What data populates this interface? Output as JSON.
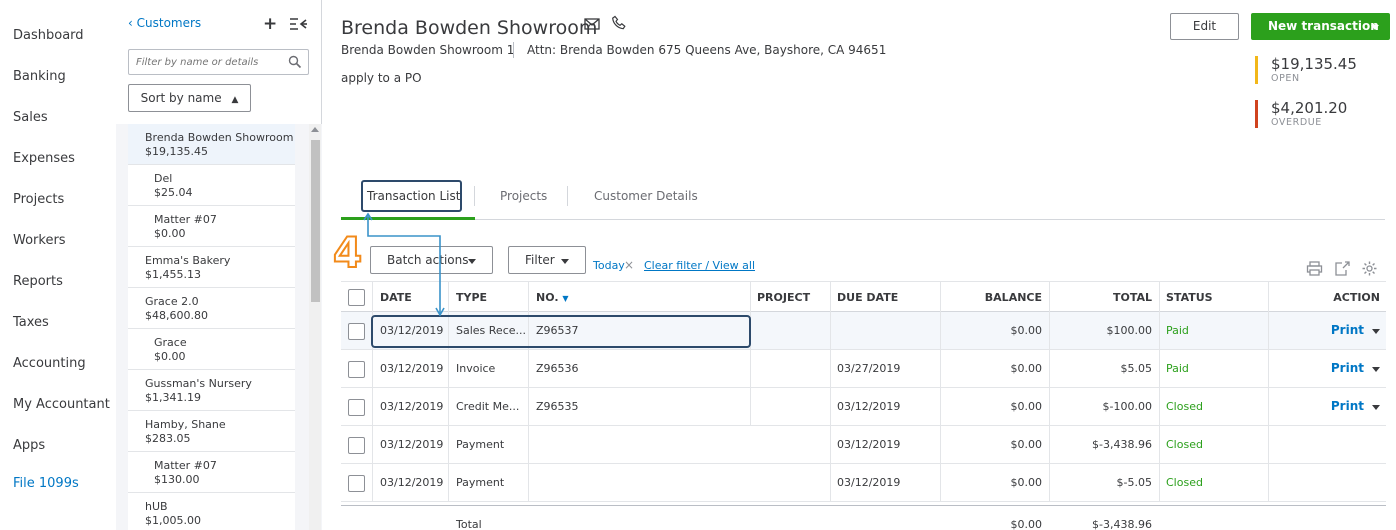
{
  "nav": {
    "items": [
      "Dashboard",
      "Banking",
      "Sales",
      "Expenses",
      "Projects",
      "Workers",
      "Reports",
      "Taxes",
      "Accounting",
      "My Accountant",
      "Apps",
      "File 1099s"
    ]
  },
  "custpanel": {
    "back_label": "Customers",
    "filter_placeholder": "Filter by name or details",
    "sort_label": "Sort by name",
    "customers": [
      {
        "name": "Brenda Bowden Showroom",
        "amount": "$19,135.45"
      },
      {
        "name": "Del",
        "amount": "$25.04"
      },
      {
        "name": "Matter #07",
        "amount": "$0.00"
      },
      {
        "name": "Emma's Bakery",
        "amount": "$1,455.13"
      },
      {
        "name": "Grace 2.0",
        "amount": "$48,600.80"
      },
      {
        "name": "Grace",
        "amount": "$0.00"
      },
      {
        "name": "Gussman's Nursery",
        "amount": "$1,341.19"
      },
      {
        "name": "Hamby, Shane",
        "amount": "$283.05"
      },
      {
        "name": "Matter #07",
        "amount": "$130.00"
      },
      {
        "name": "hUB",
        "amount": "$1,005.00"
      }
    ]
  },
  "header": {
    "title": "Brenda Bowden Showroom",
    "company": "Brenda Bowden Showroom 1",
    "attn": "Attn: Brenda Bowden 675 Queens Ave, Bayshore, CA 94651",
    "note": "apply to a PO",
    "edit_label": "Edit",
    "new_label": "New transaction",
    "open_amount": "$19,135.45",
    "open_label": "OPEN",
    "overdue_amount": "$4,201.20",
    "overdue_label": "OVERDUE",
    "colors": {
      "open": "#f2b719",
      "overdue": "#d0431f",
      "accent": "#2ca01c",
      "link": "#0077c5"
    }
  },
  "tabs": [
    "Transaction List",
    "Projects",
    "Customer Details"
  ],
  "annotation": {
    "step": "4"
  },
  "toolbar": {
    "batch_label": "Batch actions",
    "filter_label": "Filter",
    "today_label": "Today",
    "clear_label": "Clear filter / View all"
  },
  "table": {
    "headers": {
      "date": "DATE",
      "type": "TYPE",
      "no": "NO.",
      "project": "PROJECT",
      "due": "DUE DATE",
      "balance": "BALANCE",
      "total": "TOTAL",
      "status": "STATUS",
      "action": "ACTION"
    },
    "rows": [
      {
        "date": "03/12/2019",
        "type": "Sales Rece...",
        "no": "Z96537",
        "project": "",
        "due": "",
        "balance": "$0.00",
        "total": "$100.00",
        "status": "Paid",
        "action": "Print"
      },
      {
        "date": "03/12/2019",
        "type": "Invoice",
        "no": "Z96536",
        "project": "",
        "due": "03/27/2019",
        "balance": "$0.00",
        "total": "$5.05",
        "status": "Paid",
        "action": "Print"
      },
      {
        "date": "03/12/2019",
        "type": "Credit Me...",
        "no": "Z96535",
        "project": "",
        "due": "03/12/2019",
        "balance": "$0.00",
        "total": "$-100.00",
        "status": "Closed",
        "action": "Print"
      },
      {
        "date": "03/12/2019",
        "type": "Payment",
        "no": "",
        "project": "",
        "due": "03/12/2019",
        "balance": "$0.00",
        "total": "$-3,438.96",
        "status": "Closed",
        "action": ""
      },
      {
        "date": "03/12/2019",
        "type": "Payment",
        "no": "",
        "project": "",
        "due": "03/12/2019",
        "balance": "$0.00",
        "total": "$-5.05",
        "status": "Closed",
        "action": ""
      }
    ],
    "total_row": {
      "label": "Total",
      "balance": "$0.00",
      "total": "$-3,438.96"
    }
  }
}
